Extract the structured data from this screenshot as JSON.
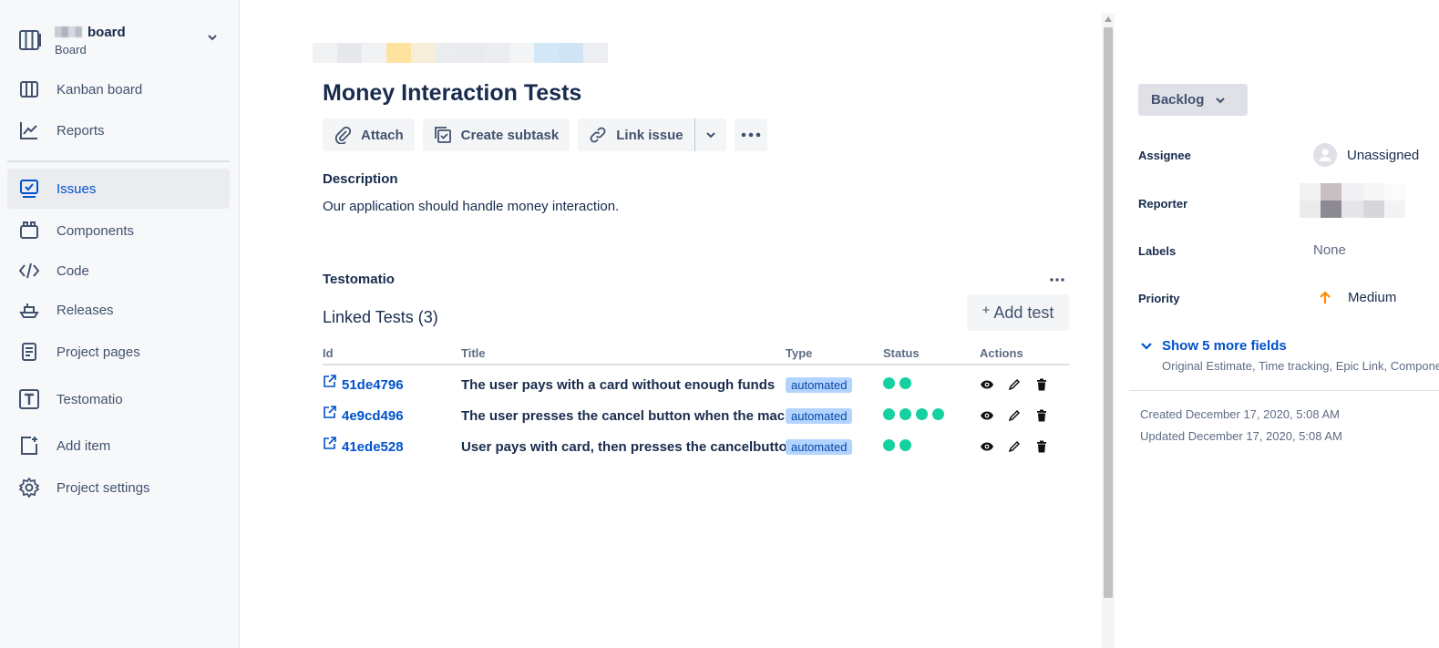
{
  "sidebar": {
    "project_name": "board",
    "project_type": "Board",
    "items": [
      {
        "label": "Kanban board",
        "icon": "kanban-board-icon"
      },
      {
        "label": "Reports",
        "icon": "reports-chart-icon"
      },
      {
        "label": "Issues",
        "icon": "issues-icon",
        "active": true
      },
      {
        "label": "Components",
        "icon": "components-icon"
      },
      {
        "label": "Code",
        "icon": "code-icon"
      },
      {
        "label": "Releases",
        "icon": "releases-ship-icon"
      },
      {
        "label": "Project pages",
        "icon": "project-pages-icon"
      },
      {
        "label": "Testomatio",
        "icon": "testomatio-icon"
      },
      {
        "label": "Add item",
        "icon": "add-item-icon"
      },
      {
        "label": "Project settings",
        "icon": "gear-icon"
      }
    ]
  },
  "issue": {
    "title": "Money Interaction Tests",
    "toolbar": {
      "attach": "Attach",
      "create_subtask": "Create subtask",
      "link_issue": "Link issue"
    },
    "description_label": "Description",
    "description_text": "Our application should handle money interaction."
  },
  "testomatio": {
    "label": "Testomatio",
    "linked_title": "Linked Tests (3)",
    "add_test": "Add test",
    "columns": {
      "id": "Id",
      "title": "Title",
      "type": "Type",
      "status": "Status",
      "actions": "Actions"
    },
    "tests": [
      {
        "id": "51de4796",
        "title": "The user pays with a card without enough funds",
        "type": "automated",
        "status_dots": 2
      },
      {
        "id": "4e9cd496",
        "title": "The user presses the cancel button when the machine",
        "type": "automated",
        "status_dots": 4
      },
      {
        "id": "41ede528",
        "title": "User pays with card, then presses the cancelbutton",
        "type": "automated",
        "status_dots": 2
      }
    ]
  },
  "details": {
    "status": "Backlog",
    "assignee_label": "Assignee",
    "assignee_value": "Unassigned",
    "reporter_label": "Reporter",
    "labels_label": "Labels",
    "labels_value": "None",
    "priority_label": "Priority",
    "priority_value": "Medium",
    "show_more": "Show 5 more fields",
    "show_more_sub": "Original Estimate, Time tracking, Epic Link, Components",
    "created": "Created December 17, 2020, 5:08 AM",
    "updated": "Updated December 17, 2020, 5:08 AM"
  },
  "colors": {
    "accent": "#0052cc",
    "status_ok": "#15d1a0",
    "priority_medium": "#ff8b00"
  }
}
